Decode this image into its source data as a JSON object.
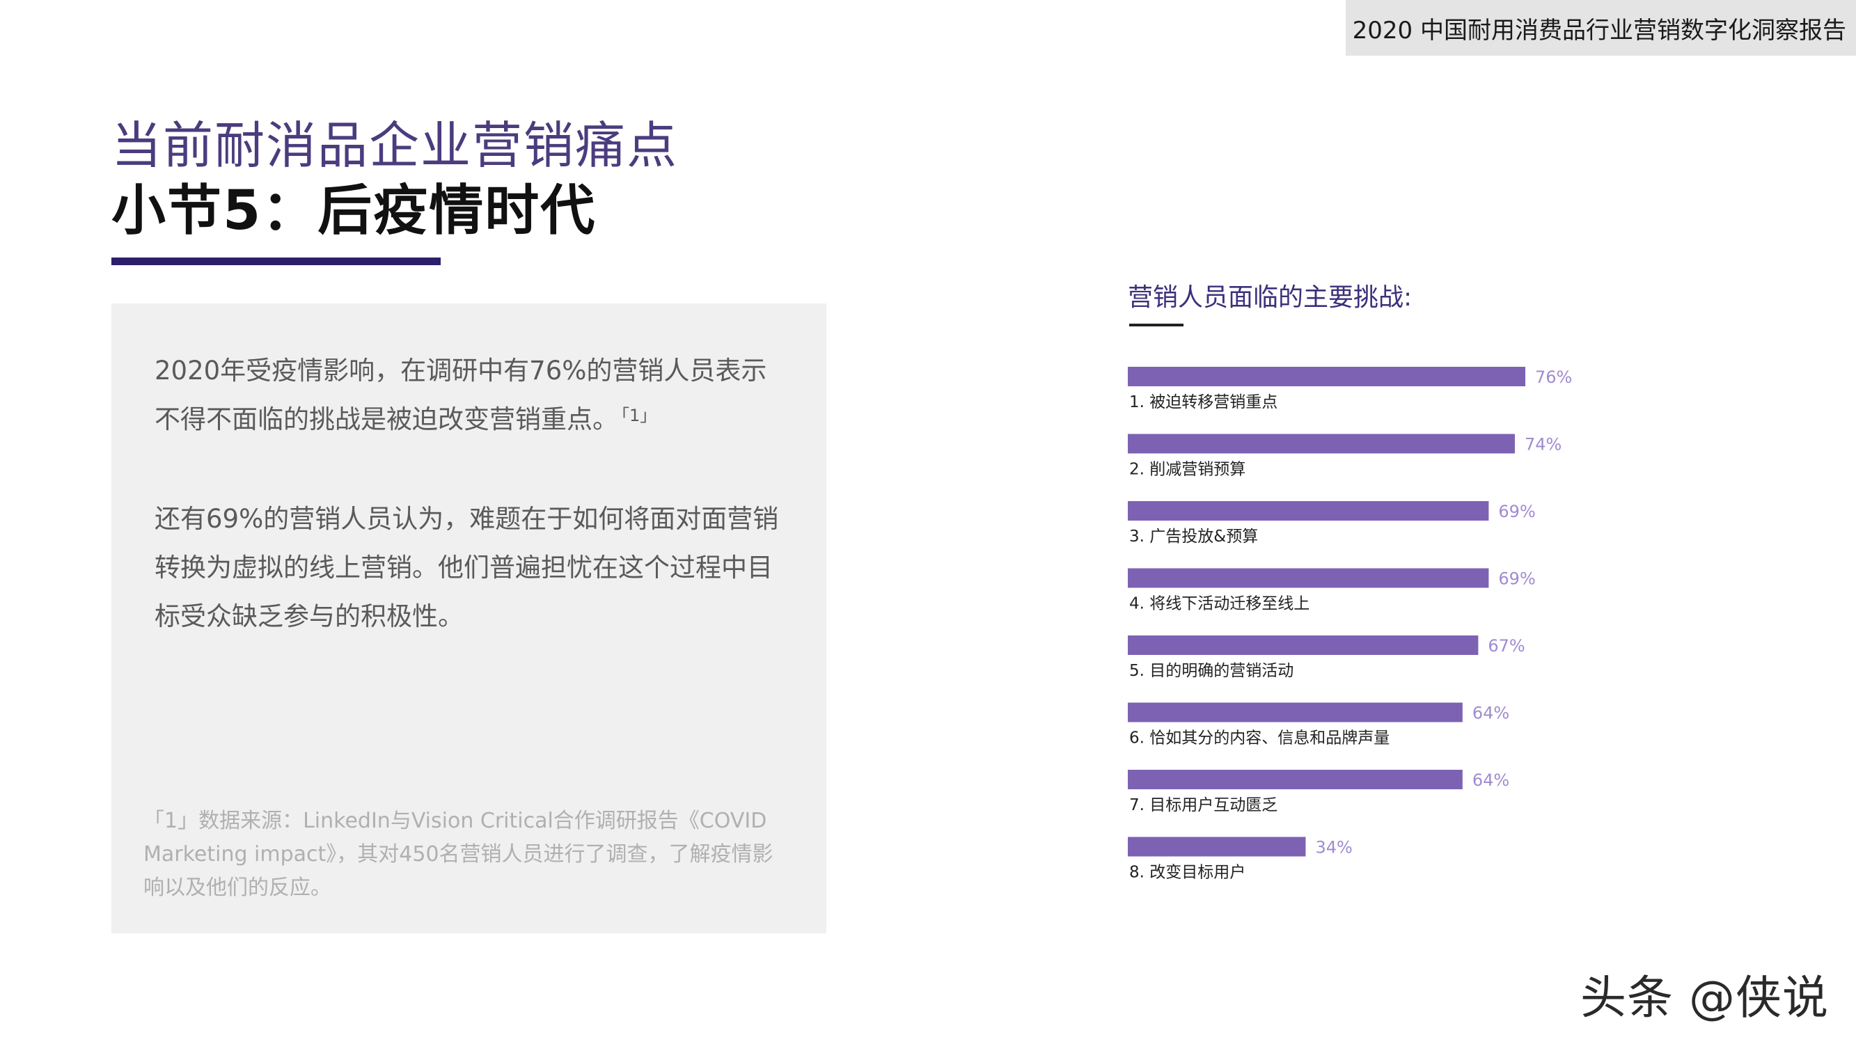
{
  "header": {
    "report_title": "2020 中国耐用消费品行业营销数字化洞察报告"
  },
  "page": {
    "title": "当前耐消品企业营销痛点",
    "subtitle": "小节5：后疫情时代"
  },
  "text_box": {
    "paragraph1": "2020年受疫情影响，在调研中有76%的营销人员表示不得不面临的挑战是被迫改变营销重点。",
    "paragraph1_ref": "「1」",
    "paragraph2": "还有69%的营销人员认为，难题在于如何将面对面营销转换为虚拟的线上营销。他们普遍担忧在这个过程中目标受众缺乏参与的积极性。",
    "footnote": "「1」数据来源：LinkedIn与Vision Critical合作调研报告《COVID Marketing impact》，其对450名营销人员进行了调查，了解疫情影响以及他们的反应。"
  },
  "chart_data": {
    "type": "bar",
    "orientation": "horizontal",
    "title": "营销人员面临的主要挑战:",
    "categories": [
      "1. 被迫转移营销重点",
      "2. 削减营销预算",
      "3. 广告投放&预算",
      "4. 将线下活动迁移至线上",
      "5. 目的明确的营销活动",
      "6. 恰如其分的内容、信息和品牌声量",
      "7. 目标用户互动匮乏",
      "8. 改变目标用户"
    ],
    "values": [
      76,
      74,
      69,
      69,
      67,
      64,
      64,
      34
    ],
    "value_labels": [
      "76%",
      "74%",
      "69%",
      "69%",
      "67%",
      "64%",
      "64%",
      "34%"
    ],
    "unit": "%",
    "xlim": [
      0,
      100
    ],
    "bar_color": "#7d62b3",
    "label_color": "#a08bd0",
    "legend": "none",
    "grid": false
  },
  "watermark": "头条 @侠说"
}
